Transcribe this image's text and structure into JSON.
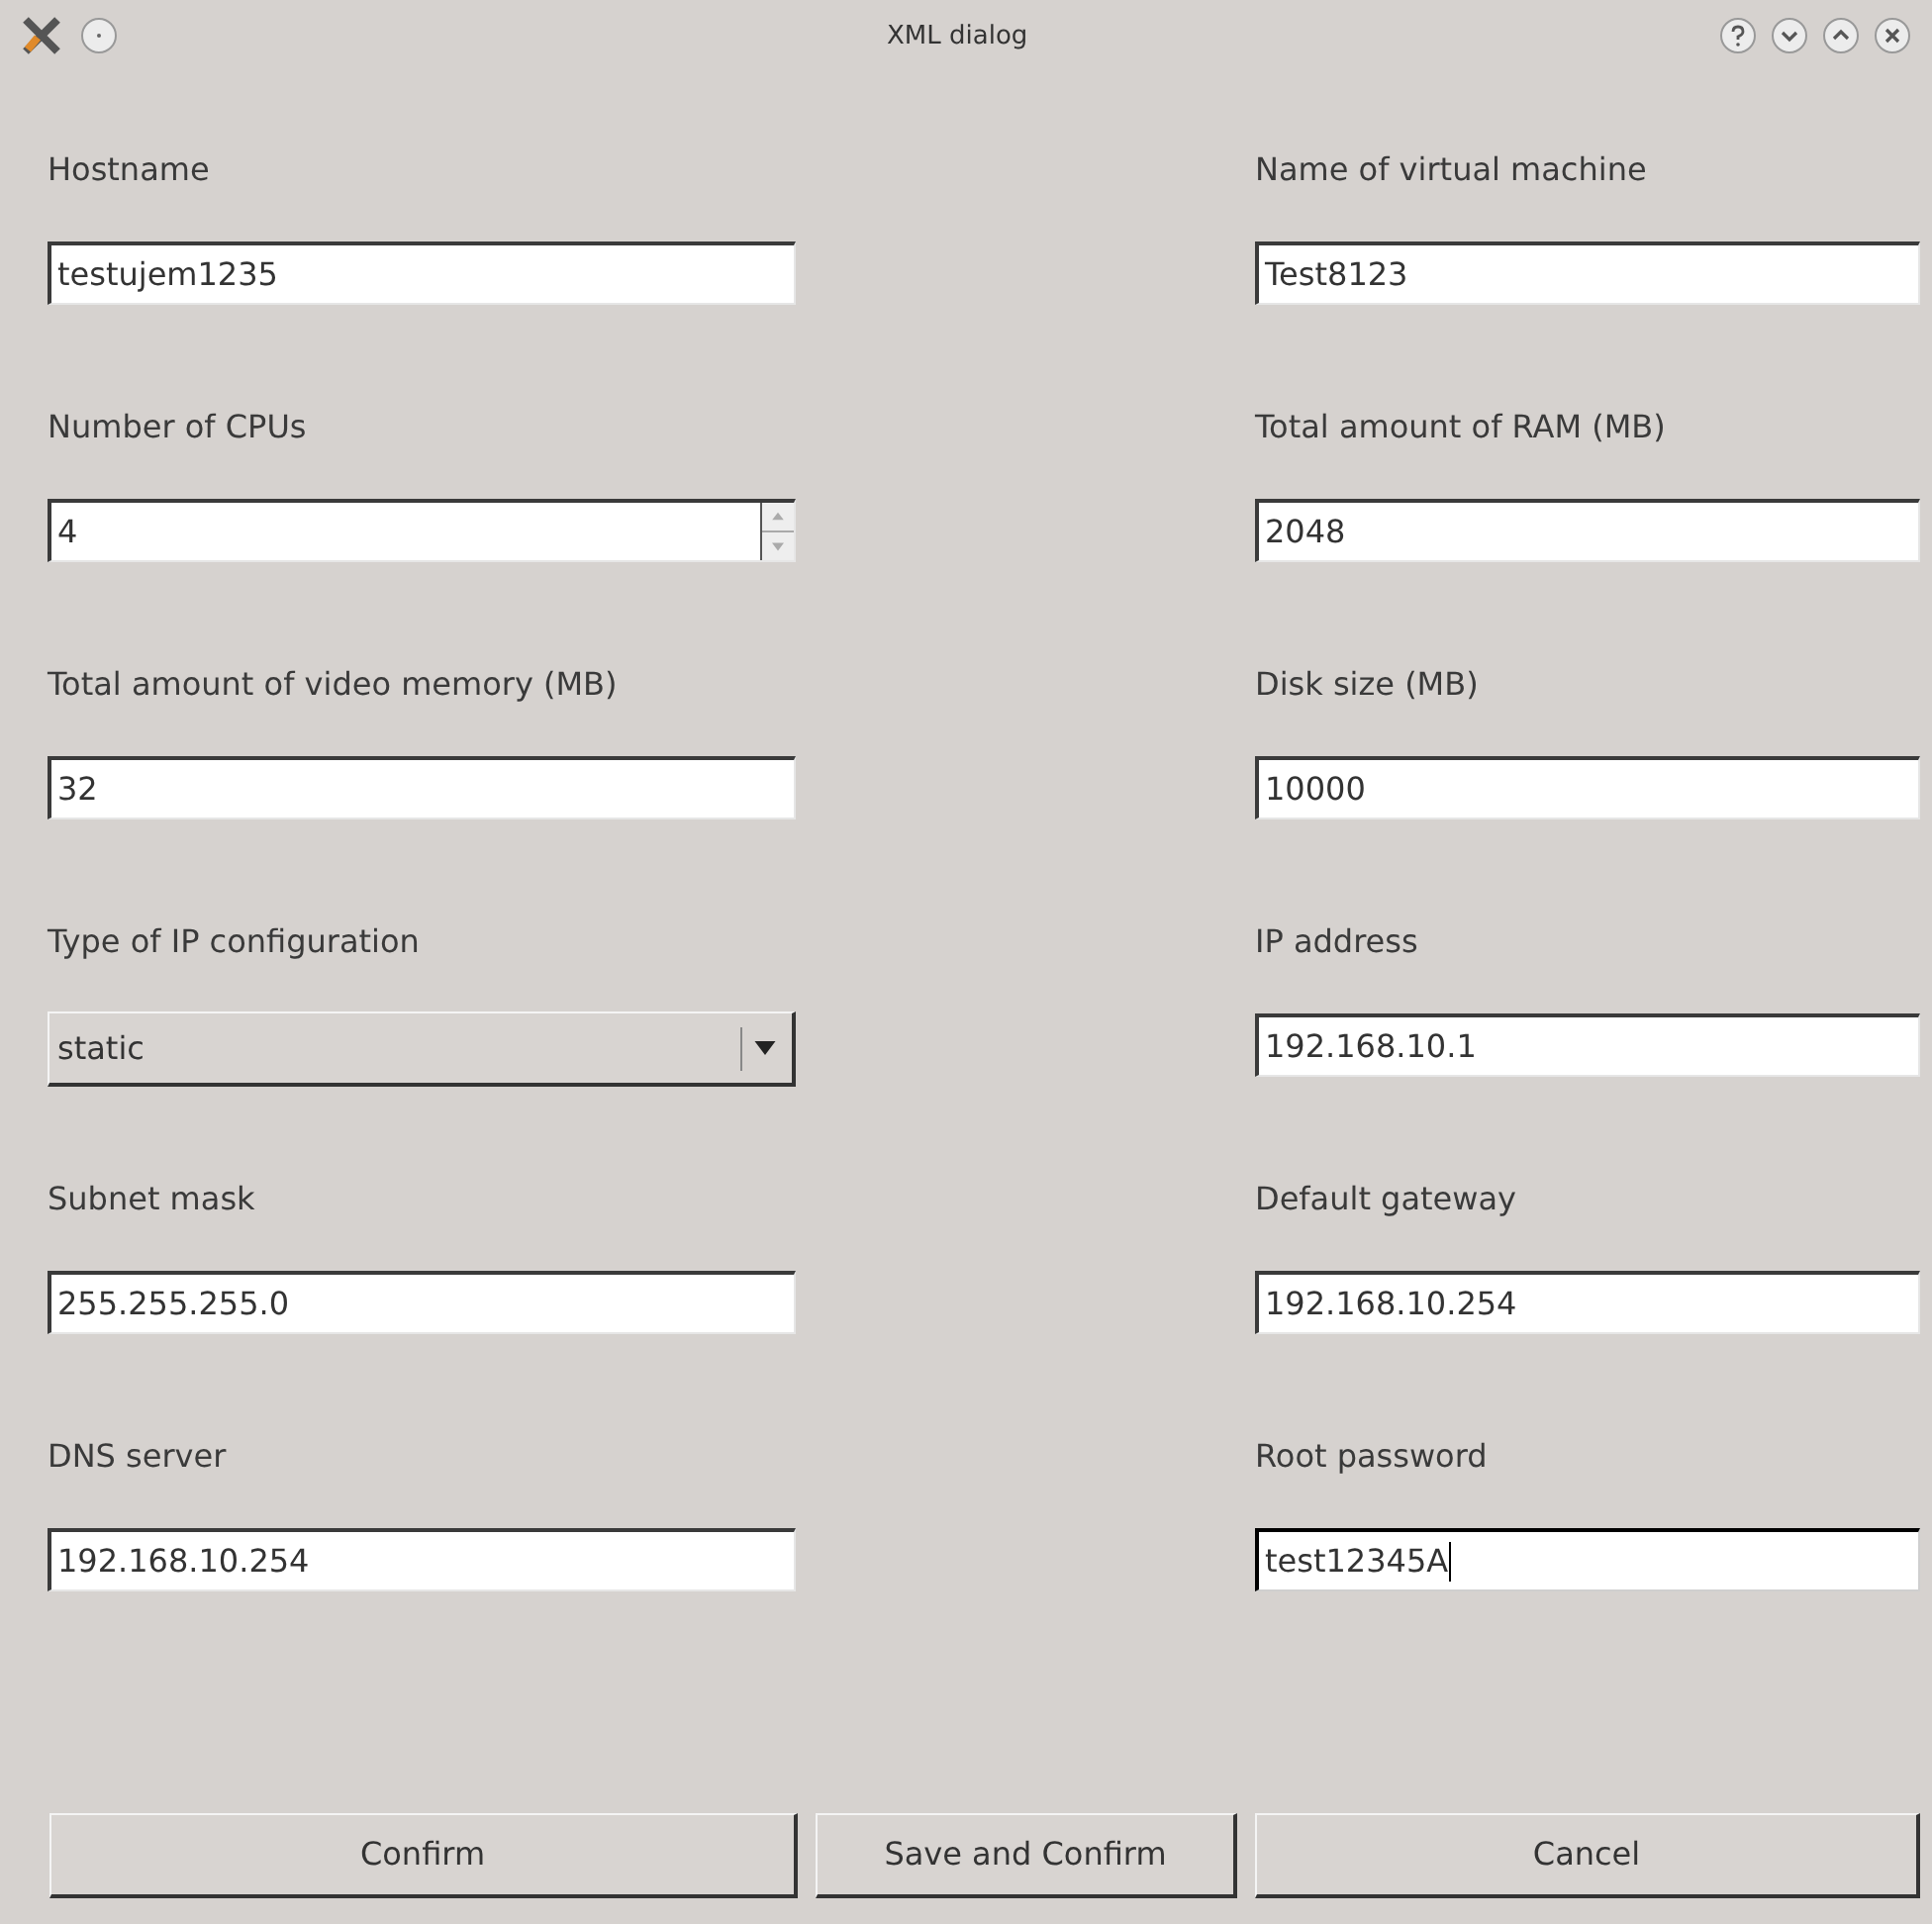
{
  "window": {
    "title": "XML dialog"
  },
  "fields": [
    {
      "label": "Hostname",
      "kind": "text",
      "value": "testujem1235",
      "focused": false
    },
    {
      "label": "Name of virtual machine",
      "kind": "text",
      "value": "Test8123",
      "focused": false
    },
    {
      "label": "Number of CPUs",
      "kind": "spin",
      "value": "4",
      "focused": false
    },
    {
      "label": "Total amount of RAM (MB)",
      "kind": "text",
      "value": "2048",
      "focused": false
    },
    {
      "label": "Total amount of video memory (MB)",
      "kind": "text",
      "value": "32",
      "focused": false
    },
    {
      "label": "Disk size (MB)",
      "kind": "text",
      "value": "10000",
      "focused": false
    },
    {
      "label": "Type of IP configuration",
      "kind": "combo",
      "value": "static"
    },
    {
      "label": "IP address",
      "kind": "text",
      "value": "192.168.10.1",
      "focused": false
    },
    {
      "label": "Subnet mask",
      "kind": "text",
      "value": "255.255.255.0",
      "focused": false
    },
    {
      "label": "Default gateway",
      "kind": "text",
      "value": "192.168.10.254",
      "focused": false
    },
    {
      "label": "DNS server",
      "kind": "text",
      "value": "192.168.10.254",
      "focused": false
    },
    {
      "label": "Root password",
      "kind": "text",
      "value": "test12345A",
      "focused": true
    }
  ],
  "buttons": [
    "Confirm",
    "Save and Confirm",
    "Cancel"
  ]
}
